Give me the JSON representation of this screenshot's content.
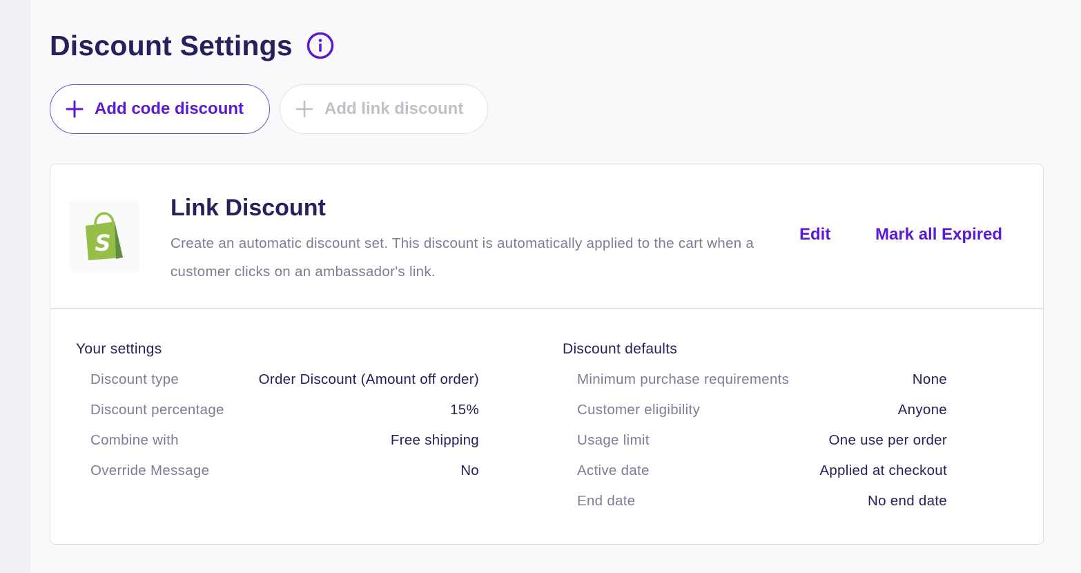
{
  "page": {
    "title": "Discount Settings",
    "info_icon": "info-circle-icon"
  },
  "actions": {
    "add_code_label": "Add code discount",
    "add_link_label": "Add link discount"
  },
  "card": {
    "logo": "shopify-bag-logo",
    "title": "Link Discount",
    "description": "Create an automatic discount set. This discount is automatically applied to the cart when a customer clicks on an ambassador's link.",
    "edit_label": "Edit",
    "expire_label": "Mark all Expired"
  },
  "your_settings": {
    "heading": "Your settings",
    "rows": [
      {
        "label": "Discount type",
        "value": "Order Discount (Amount off order)"
      },
      {
        "label": "Discount percentage",
        "value": "15%"
      },
      {
        "label": "Combine with",
        "value": "Free shipping"
      },
      {
        "label": "Override Message",
        "value": "No"
      }
    ]
  },
  "discount_defaults": {
    "heading": "Discount defaults",
    "rows": [
      {
        "label": "Minimum purchase requirements",
        "value": "None"
      },
      {
        "label": "Customer eligibility",
        "value": "Anyone"
      },
      {
        "label": "Usage limit",
        "value": "One use per order"
      },
      {
        "label": "Active date",
        "value": "Applied at checkout"
      },
      {
        "label": "End date",
        "value": "No end date"
      }
    ]
  },
  "colors": {
    "accent": "#5b19d7",
    "title": "#26215a",
    "muted": "#7f7c95",
    "disabled": "#c1c0c8",
    "shopify_green": "#95bf47"
  }
}
